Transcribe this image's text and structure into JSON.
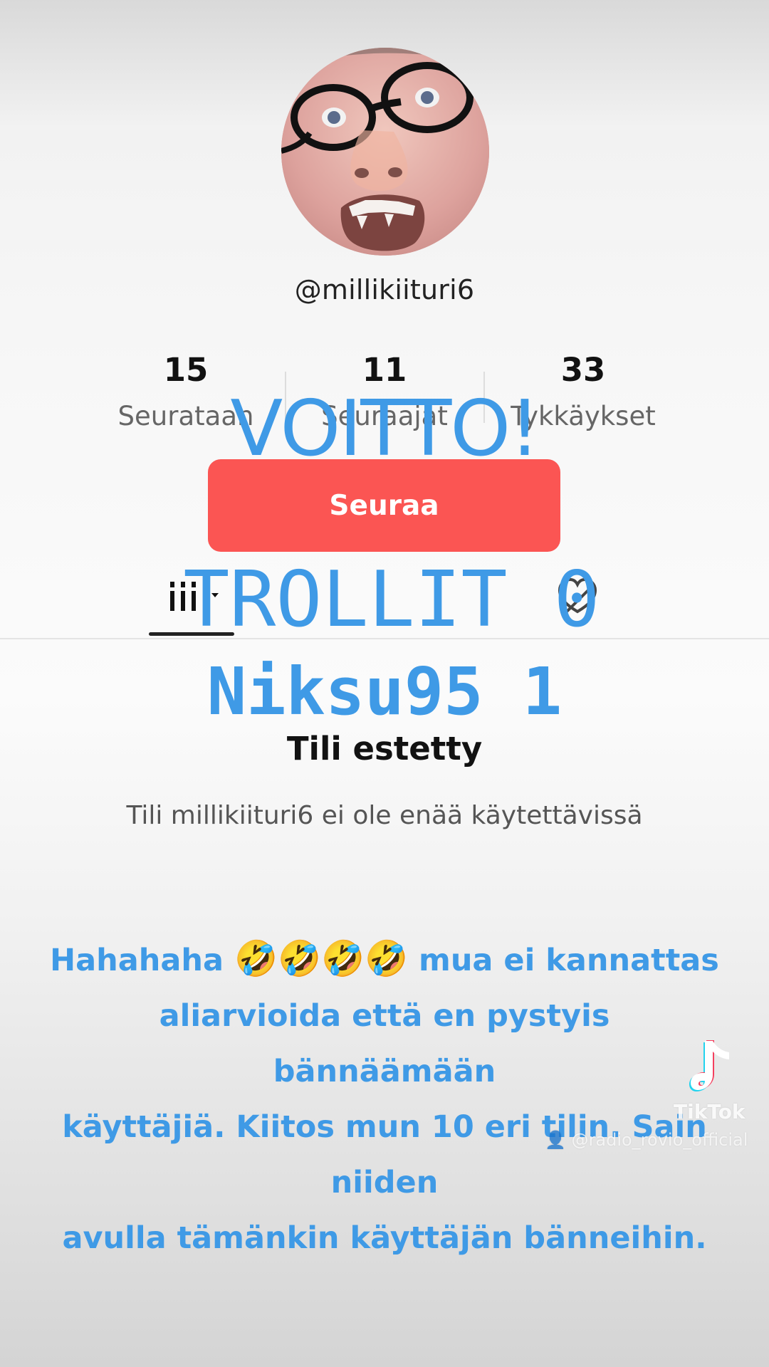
{
  "profile": {
    "username": "@millikiituri6",
    "stats": [
      {
        "value": "15",
        "label": "Seurataan"
      },
      {
        "value": "11",
        "label": "Seuraajat"
      },
      {
        "value": "33",
        "label": "Tykkäykset"
      }
    ],
    "follow_button": "Seuraa"
  },
  "overlay": {
    "line1": "VOITTO!",
    "line2": "TROLLIT 0",
    "line3": "Niksu95 1"
  },
  "blocked": {
    "title": "Tili estetty",
    "subtitle": "Tili millikiituri6 ei ole enää käytettävissä"
  },
  "caption": {
    "text_before_emojis": "Hahahaha ",
    "emojis": "🤣🤣🤣🤣",
    "line1_rest": " mua ei kannattas",
    "line2": "aliarvioida että en pystyis bännäämään",
    "line3": "käyttäjiä. Kiitos mun 10 eri tilin. Sain niiden",
    "line4": "avulla tämänkin käyttäjän bänneihin."
  },
  "watermark": {
    "brand": "TikTok",
    "user": "@radio_rovio_official"
  },
  "colors": {
    "follow_button": "#fb5553",
    "overlay_text": "#3f9ae6",
    "caption_text": "#3f9ae6"
  },
  "icons": {
    "grid_tab": "grid-icon",
    "liked_tab": "heart-slash-icon",
    "tiktok_logo": "tiktok-logo-icon",
    "watermark_user": "person-icon"
  }
}
